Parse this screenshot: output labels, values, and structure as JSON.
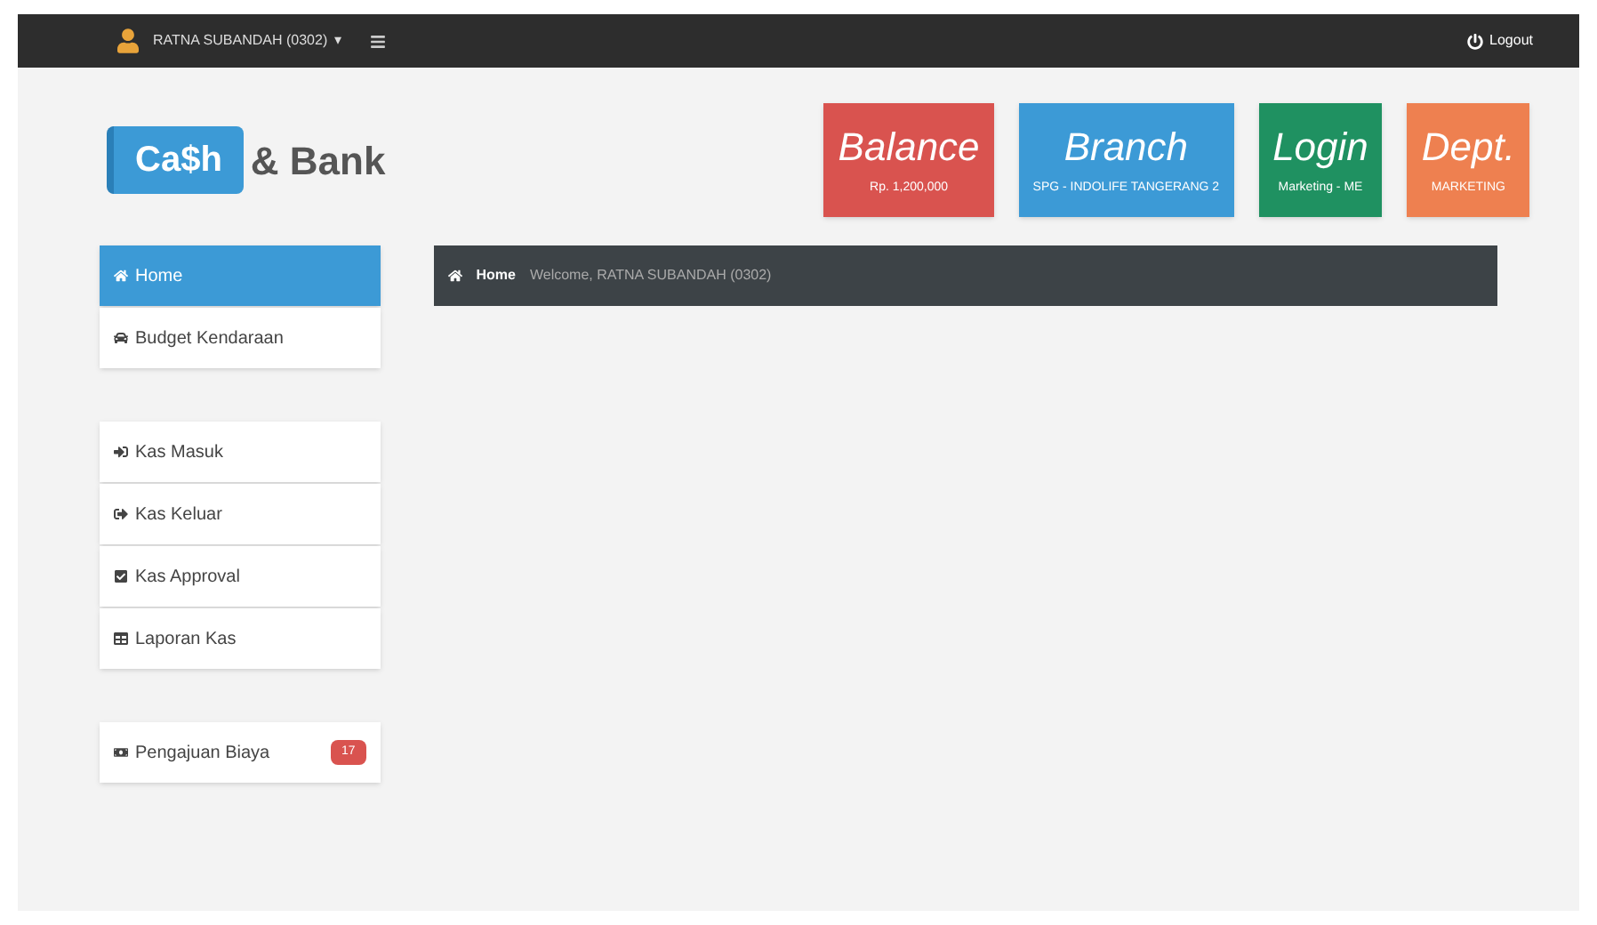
{
  "top_bar": {
    "user": "RATNA SUBANDAH (0302)",
    "caret": "▾",
    "logout": "Logout"
  },
  "logo": {
    "badge": "Ca$h",
    "text": "& Bank"
  },
  "info_cards": [
    {
      "title": "Balance",
      "value": "Rp. 1,200,000",
      "color": "#d9534f"
    },
    {
      "title": "Branch",
      "value": "SPG - INDOLIFE TANGERANG 2",
      "color": "#3c9ad6"
    },
    {
      "title": "Login",
      "value": "Marketing - ME",
      "color": "#1f9161"
    },
    {
      "title": "Dept.",
      "value": "MARKETING",
      "color": "#ee8050"
    }
  ],
  "sidebar": {
    "groups": [
      {
        "items": [
          {
            "label": "Home",
            "kind": "home",
            "selected": true
          },
          {
            "label": "Budget Kendaraan",
            "kind": "car",
            "selected": false
          }
        ]
      },
      {
        "items": [
          {
            "label": "Kas Masuk",
            "kind": "in",
            "selected": false
          },
          {
            "label": "Kas Keluar",
            "kind": "out",
            "selected": false
          },
          {
            "label": "Kas Approval",
            "kind": "check",
            "selected": false
          },
          {
            "label": "Laporan Kas",
            "kind": "table",
            "selected": false
          }
        ]
      },
      {
        "items": [
          {
            "label": "Pengajuan Biaya",
            "kind": "money",
            "selected": false,
            "badge": "17"
          }
        ]
      }
    ]
  },
  "breadcrumb": {
    "current": "Home",
    "welcome": "Welcome, RATNA SUBANDAH (0302)"
  }
}
